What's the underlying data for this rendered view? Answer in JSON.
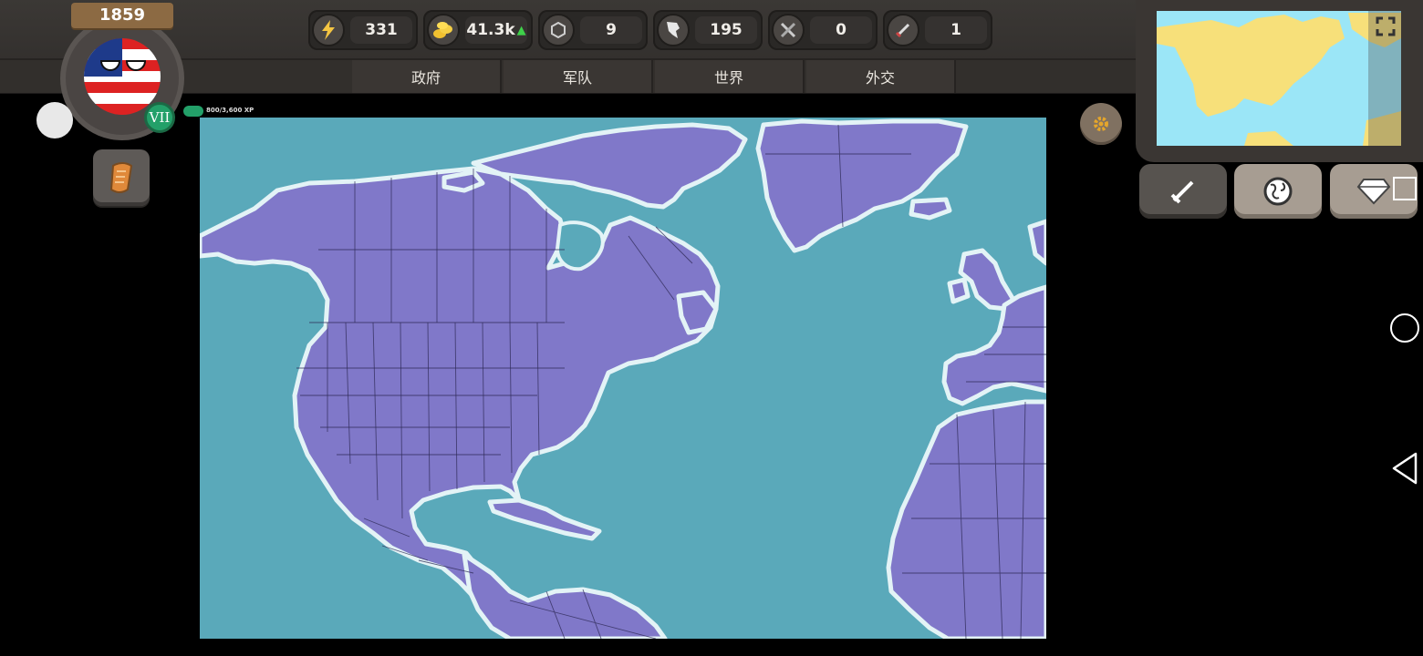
{
  "header": {
    "year": "1859",
    "level": "VII",
    "xp": "800/3,600 XP"
  },
  "stats": [
    {
      "icon": "lightning-icon",
      "value": "331"
    },
    {
      "icon": "gold-coins-icon",
      "value": "41.3k",
      "trend": "up"
    },
    {
      "icon": "gem-icon",
      "value": "9"
    },
    {
      "icon": "territory-icon",
      "value": "195"
    },
    {
      "icon": "crossed-swords-icon",
      "value": "0"
    },
    {
      "icon": "sword-icon",
      "value": "1"
    }
  ],
  "tabs": [
    {
      "label": "政府"
    },
    {
      "label": "军队"
    },
    {
      "label": "世界"
    },
    {
      "label": "外交"
    }
  ],
  "colors": {
    "ocean": "#5aa9ba",
    "land": "#8078c9",
    "minimap_land": "#f7e07a",
    "minimap_ocean": "#9be6f7"
  }
}
